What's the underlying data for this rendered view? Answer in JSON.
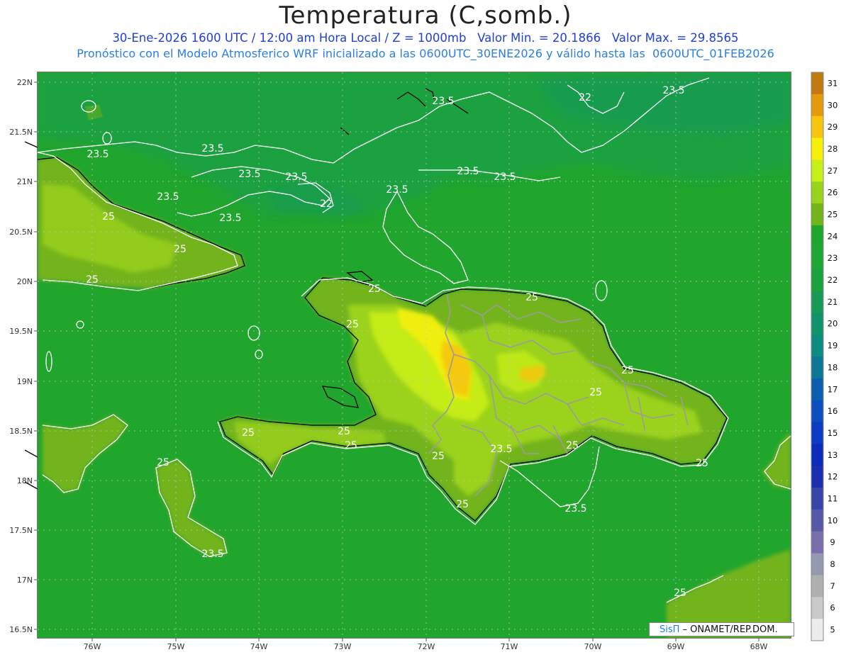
{
  "title": "Temperatura (C,somb.)",
  "subtitle_line1": "30-Ene-2026 1600 UTC / 12:00 am Hora Local / Z = 1000mb   Valor Min. = 20.1866   Valor Max. = 29.8565",
  "subtitle_line2": "Pronóstico con el Modelo Atmosferico WRF inicializado a las 0600UTC_30ENE2026 y válido hasta las  0600UTC_01FEB2026",
  "credit": {
    "brand": "SisΠ",
    "text": " – ONAMET/REP.DOM."
  },
  "axes": {
    "lat_labels": [
      "22N",
      "21.5N",
      "21N",
      "20.5N",
      "20N",
      "19.5N",
      "19N",
      "18.5N",
      "18N",
      "17.5N",
      "17N",
      "16.5N"
    ],
    "lon_labels": [
      "76W",
      "75W",
      "74W",
      "73W",
      "72W",
      "71W",
      "70W",
      "69W",
      "68W"
    ]
  },
  "colorbar": {
    "levels": [
      "31",
      "30",
      "29",
      "28",
      "27",
      "26",
      "25",
      "24",
      "23",
      "22",
      "21",
      "20",
      "19",
      "18",
      "17",
      "16",
      "15",
      "13",
      "12",
      "11",
      "10",
      "9",
      "8",
      "7",
      "6",
      "5"
    ],
    "colors": [
      "#c07a10",
      "#e39a0c",
      "#f6c50d",
      "#f5f007",
      "#c9ef18",
      "#9bd21b",
      "#73b41a",
      "#20a52d",
      "#20a634",
      "#1ca13f",
      "#179a55",
      "#12926a",
      "#0e8a80",
      "#0b7795",
      "#0a5fad",
      "#0b4fbf",
      "#0c3cc2",
      "#0b2bb8",
      "#1b2eae",
      "#3845a8",
      "#5658a8",
      "#7a6fab",
      "#939ab0",
      "#aeb0b0",
      "#c9c9c9",
      "#ececec"
    ]
  },
  "contour_labels": [
    "23.5",
    "23.5",
    "22",
    "23.5",
    "23.5",
    "23.5",
    "23.5",
    "23.5",
    "23.5",
    "22",
    "23.5",
    "23.5",
    "25",
    "23.5",
    "25",
    "25",
    "25",
    "25",
    "25",
    "25",
    "25",
    "25",
    "25",
    "25",
    "23.5",
    "25",
    "25",
    "23.5",
    "25",
    "25",
    "25",
    "23.5",
    "25"
  ]
}
